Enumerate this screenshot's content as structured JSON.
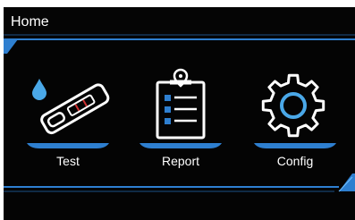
{
  "header": {
    "title": "Home"
  },
  "menu": {
    "items": [
      {
        "label": "Test",
        "icon": "test-strip-icon"
      },
      {
        "label": "Report",
        "icon": "clipboard-report-icon"
      },
      {
        "label": "Config",
        "icon": "gear-icon"
      }
    ]
  },
  "colors": {
    "background": "#040404",
    "accent": "#2e7fd0",
    "accent_light": "#4aa8e8",
    "text": "#ffffff"
  }
}
